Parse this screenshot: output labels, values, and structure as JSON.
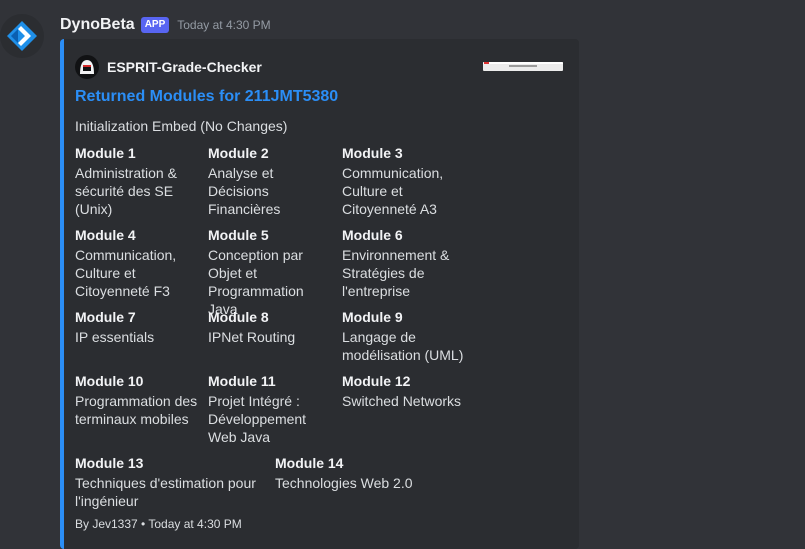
{
  "message": {
    "username": "DynoBeta",
    "badge": "APP",
    "timestamp": "Today at 4:30 PM"
  },
  "embed": {
    "accent_color": "#2b8ef6",
    "author": "ESPRIT-Grade-Checker",
    "title": "Returned Modules for 211JMT5380",
    "description": "Initialization Embed (No Changes)",
    "fields": [
      {
        "name": "Module 1",
        "value": "Administration & sécurité des SE (Unix)"
      },
      {
        "name": "Module 2",
        "value": "Analyse et Décisions Financières"
      },
      {
        "name": "Module 3",
        "value": "Communication, Culture et Citoyenneté A3"
      },
      {
        "name": "Module 4",
        "value": "Communication, Culture et Citoyenneté F3"
      },
      {
        "name": "Module 5",
        "value": "Conception par Objet et Programmation Java"
      },
      {
        "name": "Module 6",
        "value": "Environnement & Stratégies de l'entreprise"
      },
      {
        "name": "Module 7",
        "value": "IP essentials"
      },
      {
        "name": "Module 8",
        "value": "IPNet Routing"
      },
      {
        "name": "Module 9",
        "value": "Langage de modélisation (UML)"
      },
      {
        "name": "Module 10",
        "value": "Programmation des terminaux mobiles"
      },
      {
        "name": "Module 11",
        "value": "Projet Intégré : Développement Web Java"
      },
      {
        "name": "Module 12",
        "value": "Switched Networks"
      },
      {
        "name": "Module 13",
        "value": "Techniques d'estimation pour l'ingénieur"
      },
      {
        "name": "Module 14",
        "value": "Technologies Web 2.0"
      }
    ],
    "footer": "By Jev1337 • Today at 4:30 PM"
  }
}
